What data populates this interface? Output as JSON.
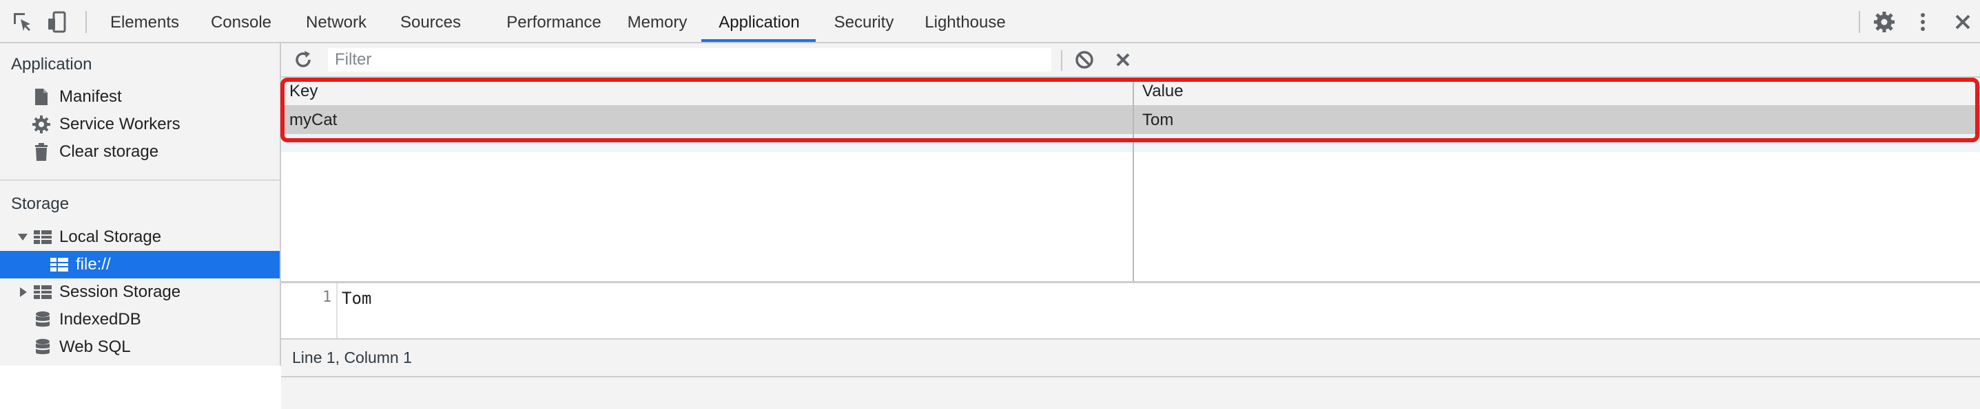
{
  "toolbar": {
    "tabs": [
      {
        "label": "Elements"
      },
      {
        "label": "Console"
      },
      {
        "label": "Network"
      },
      {
        "label": "Sources"
      },
      {
        "label": "Performance"
      },
      {
        "label": "Memory"
      },
      {
        "label": "Application"
      },
      {
        "label": "Security"
      },
      {
        "label": "Lighthouse"
      }
    ],
    "active_tab": "Application",
    "icons": [
      "inspect-element-icon",
      "device-toggle-icon",
      "settings-gear-icon",
      "more-options-icon",
      "close-icon"
    ]
  },
  "sidebar": {
    "application": {
      "title": "Application",
      "items": [
        {
          "label": "Manifest",
          "icon": "document-icon"
        },
        {
          "label": "Service Workers",
          "icon": "gear-icon"
        },
        {
          "label": "Clear storage",
          "icon": "trash-icon"
        }
      ]
    },
    "storage": {
      "title": "Storage",
      "items": [
        {
          "label": "Local Storage",
          "icon": "grid-icon",
          "expanded": true
        },
        {
          "label": "file://",
          "icon": "grid-icon",
          "selected": true
        },
        {
          "label": "Session Storage",
          "icon": "grid-icon",
          "expanded": false
        },
        {
          "label": "IndexedDB",
          "icon": "database-icon"
        },
        {
          "label": "Web SQL",
          "icon": "database-icon"
        }
      ]
    }
  },
  "filterbar": {
    "placeholder": "Filter",
    "icons": [
      "refresh-icon",
      "block-icon",
      "clear-icon"
    ]
  },
  "grid": {
    "headers": [
      "Key",
      "Value"
    ],
    "rows": [
      {
        "key": "myCat",
        "value": "Tom"
      }
    ]
  },
  "preview": {
    "line_number": "1",
    "text": "Tom"
  },
  "status": {
    "text": "Line 1, Column 1"
  },
  "colors": {
    "accent": "#1a73e8",
    "highlight": "#e51b1b",
    "toolbar_bg": "#f3f3f3",
    "selected_row": "#cecece"
  }
}
